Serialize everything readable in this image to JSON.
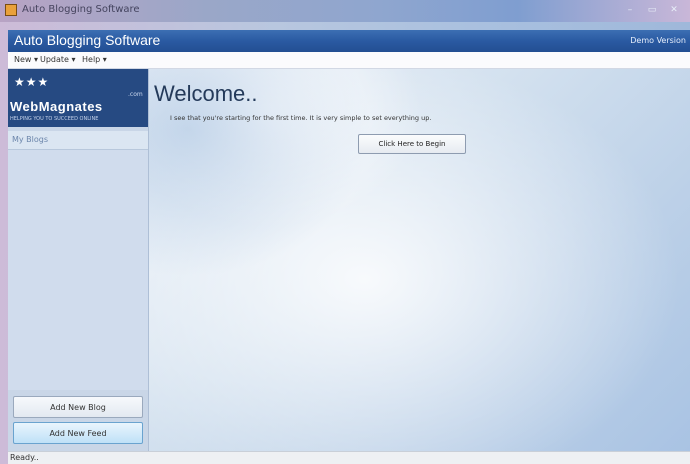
{
  "window": {
    "title": "Auto Blogging Software",
    "controls": {
      "minimize": "–",
      "maximize": "▭",
      "close": "✕"
    }
  },
  "header": {
    "app_title": "Auto Blogging Software",
    "version_label": "Demo Version"
  },
  "menu": {
    "items": [
      {
        "label": "New ▾"
      },
      {
        "label": "Update ▾"
      },
      {
        "label": "Help ▾"
      }
    ]
  },
  "sidebar": {
    "logo": {
      "stars": "★★★",
      "suffix": ".com",
      "name": "WebMagnates",
      "tagline": "HELPING YOU TO SUCCEED ONLINE"
    },
    "section_label": "My Blogs",
    "buttons": {
      "add_blog": "Add New Blog",
      "add_feed": "Add New Feed"
    }
  },
  "main": {
    "welcome_title": "Welcome..",
    "welcome_text": "I see that you're starting for the first time. It is very simple to set everything up.",
    "begin_button": "Click Here to Begin"
  },
  "status": {
    "text": "Ready.."
  },
  "colors": {
    "header_blue": "#2a5aa2",
    "logo_blue": "#264a82",
    "sidebar_bg": "#c9d6e7",
    "feed_button_accent": "#bfe1f7"
  }
}
